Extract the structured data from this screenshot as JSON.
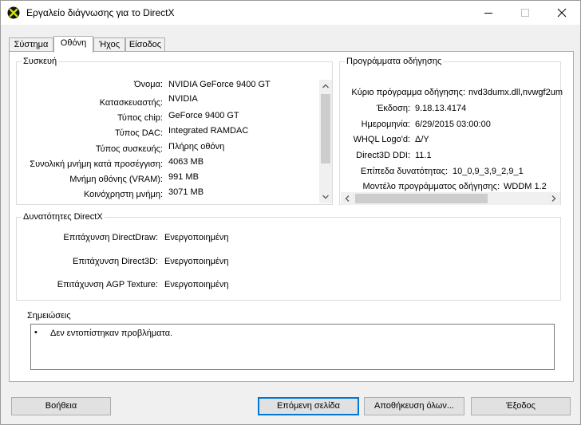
{
  "window": {
    "title": "Εργαλείο διάγνωσης για το DirectX"
  },
  "tabs": [
    {
      "label": "Σύστημα"
    },
    {
      "label": "Οθόνη"
    },
    {
      "label": "Ήχος"
    },
    {
      "label": "Είσοδος"
    }
  ],
  "device": {
    "title": "Συσκευή",
    "rows": [
      {
        "label": "Όνομα:",
        "value": "NVIDIA GeForce 9400 GT"
      },
      {
        "label": "Κατασκευαστής:",
        "value": "NVIDIA"
      },
      {
        "label": "Τύπος chip:",
        "value": "GeForce 9400 GT"
      },
      {
        "label": "Τύπος DAC:",
        "value": "Integrated RAMDAC"
      },
      {
        "label": "Τύπος συσκευής:",
        "value": "Πλήρης οθόνη"
      },
      {
        "label": "Συνολική μνήμη κατά προσέγγιση:",
        "value": "4063 MB"
      },
      {
        "label": "Μνήμη οθόνης (VRAM):",
        "value": "991 MB"
      },
      {
        "label": "Κοινόχρηστη μνήμη:",
        "value": "3071 MB"
      }
    ]
  },
  "drivers": {
    "title": "Προγράμματα οδήγησης",
    "rows": [
      {
        "label": "Κύριο πρόγραμμα οδήγησης:",
        "value": "nvd3dumx.dll,nvwgf2um"
      },
      {
        "label": "Έκδοση:",
        "value": "9.18.13.4174"
      },
      {
        "label": "Ημερομηνία:",
        "value": "6/29/2015 03:00:00"
      },
      {
        "label": "WHQL Logo'd:",
        "value": "Δ/Υ"
      },
      {
        "label": "Direct3D DDI:",
        "value": "11.1"
      },
      {
        "label": "Επίπεδα δυνατότητας:",
        "value": "10_0,9_3,9_2,9_1"
      },
      {
        "label": "Μοντέλο προγράμματος οδήγησης:",
        "value": "WDDM 1.2"
      }
    ]
  },
  "features": {
    "title": "Δυνατότητες DirectX",
    "rows": [
      {
        "label": "Επιτάχυνση DirectDraw:",
        "value": "Ενεργοποιημένη"
      },
      {
        "label": "Επιτάχυνση Direct3D:",
        "value": "Ενεργοποιημένη"
      },
      {
        "label": "Επιτάχυνση AGP Texture:",
        "value": "Ενεργοποιημένη"
      }
    ]
  },
  "notes": {
    "title": "Σημειώσεις",
    "bullet": "•",
    "items": [
      {
        "text": "Δεν εντοπίστηκαν προβλήματα."
      }
    ]
  },
  "buttons": {
    "help": "Βοήθεια",
    "next": "Επόμενη σελίδα",
    "save": "Αποθήκευση όλων...",
    "exit": "Έξοδος"
  },
  "colors": {
    "accent": "#0078d7",
    "panel": "#ffffff",
    "chrome": "#f0f0f0"
  },
  "icons": {
    "app": "directx-x-icon",
    "minimize": "minimize-icon",
    "maximize": "maximize-icon",
    "close": "close-icon"
  }
}
